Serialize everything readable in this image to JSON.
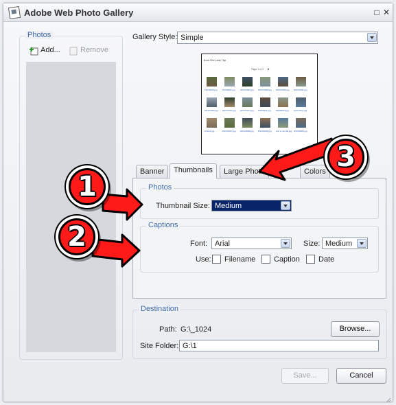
{
  "window": {
    "title": "Adobe Web Photo Gallery"
  },
  "photos": {
    "label": "Photos",
    "add_label": "Add...",
    "remove_label": "Remove"
  },
  "gallery_style": {
    "label": "Gallery Style:",
    "value": "Simple"
  },
  "preview": {
    "heading": "from Our Last Trip",
    "pager": "Page 1 of 2",
    "captions": [
      "P1010016.jpg",
      "P1010021.jpg",
      "DSCF0021.jpg",
      "DSCF0029.jpg",
      "DSCF0030.jpg",
      "DSCF0031.jpg",
      "DSCF0032.jpg",
      "DSCF0072.jpg",
      "DSCF0074.jpg",
      "P9290031.jpg",
      "P9290034.jpg",
      "writesched.jpg",
      "writes1.jpg",
      "DSC00007.jpg",
      "DSC00089.jpg",
      "DSC00099.jpg",
      "Fun in the lab.jpg",
      "DSC00082.jpg"
    ]
  },
  "tabs": [
    "Banner",
    "Thumbnails",
    "Large Photo",
    "Colors"
  ],
  "thumbnails": {
    "photos_group": "Photos",
    "size_label": "Thumbnail Size:",
    "size_value": "Medium",
    "captions_group": "Captions",
    "font_label": "Font:",
    "font_value": "Arial",
    "fontsize_label": "Size:",
    "fontsize_value": "Medium",
    "use_label": "Use:",
    "filename_label": "Filename",
    "caption_label": "Caption",
    "date_label": "Date"
  },
  "destination": {
    "label": "Destination",
    "path_label": "Path:",
    "path_value": "G:\\_1024",
    "browse_label": "Browse...",
    "site_folder_label": "Site Folder:",
    "site_folder_value": "G:\\1"
  },
  "footer": {
    "save_label": "Save...",
    "cancel_label": "Cancel"
  },
  "markers": [
    "1",
    "2",
    "3"
  ],
  "colors": {
    "marker": "#ff1a1a",
    "group_label": "#3f6aa8",
    "selection": "#0a246a"
  }
}
